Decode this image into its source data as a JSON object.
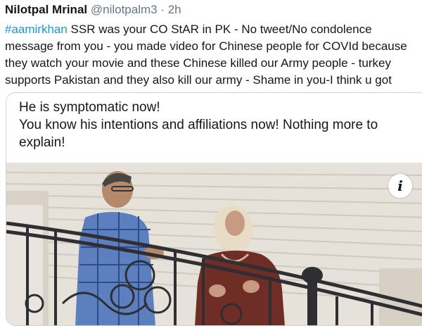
{
  "tweet": {
    "display_name": "Nilotpal Mrinal",
    "handle": "@nilotpalm3",
    "separator": " · ",
    "time": "2h",
    "hashtag": "#aamirkhan",
    "text": " SSR was your CO StAR in PK - No tweet/No condolence message from you - you made video for Chinese people for COVId because they watch your movie and these Chinese killed our Army people - turkey supports Pakistan and they also kill our army - Shame in you-I think u got"
  },
  "quoted_card": {
    "line1": "He is symptomatic now!",
    "line2": "You know his intentions and affiliations now! Nothing more to explain!",
    "info_glyph": "i"
  },
  "colors": {
    "hashtag": "#1b95e0",
    "handle": "#657786",
    "card_border": "#ccd6dd"
  },
  "icons": {
    "info": "info-icon"
  }
}
